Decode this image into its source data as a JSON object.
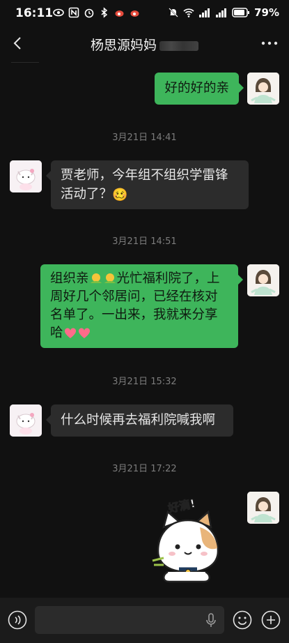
{
  "status_bar": {
    "time": "16:11",
    "battery": "79%",
    "network": "5G"
  },
  "header": {
    "title": "杨思源妈妈",
    "back_icon": "chevron-left-icon",
    "more_icon": "more-dots-icon"
  },
  "messages": [
    {
      "type": "text",
      "side": "right",
      "text": "好的好的亲"
    },
    {
      "type": "timestamp",
      "text": "3月21日 14:41"
    },
    {
      "type": "text",
      "side": "left",
      "text": "贾老师，今年组不组织学雷锋活动了？",
      "emoji": "🥴"
    },
    {
      "type": "timestamp",
      "text": "3月21日 14:51"
    },
    {
      "type": "text",
      "side": "right",
      "parts": [
        "组织亲",
        "光忙福利院了，上周好几个邻居问，已经在核对名单了。一出来，我就来分享哈"
      ]
    },
    {
      "type": "timestamp",
      "text": "3月21日 15:32"
    },
    {
      "type": "text",
      "side": "left",
      "text": "什么时候再去福利院喊我啊"
    },
    {
      "type": "timestamp",
      "text": "3月21日 17:22"
    },
    {
      "type": "sticker",
      "side": "right",
      "caption": "好滴!"
    }
  ],
  "colors": {
    "green_bubble": "#3eb55b",
    "gray_bubble": "#2c2c2c",
    "background": "#111111"
  }
}
